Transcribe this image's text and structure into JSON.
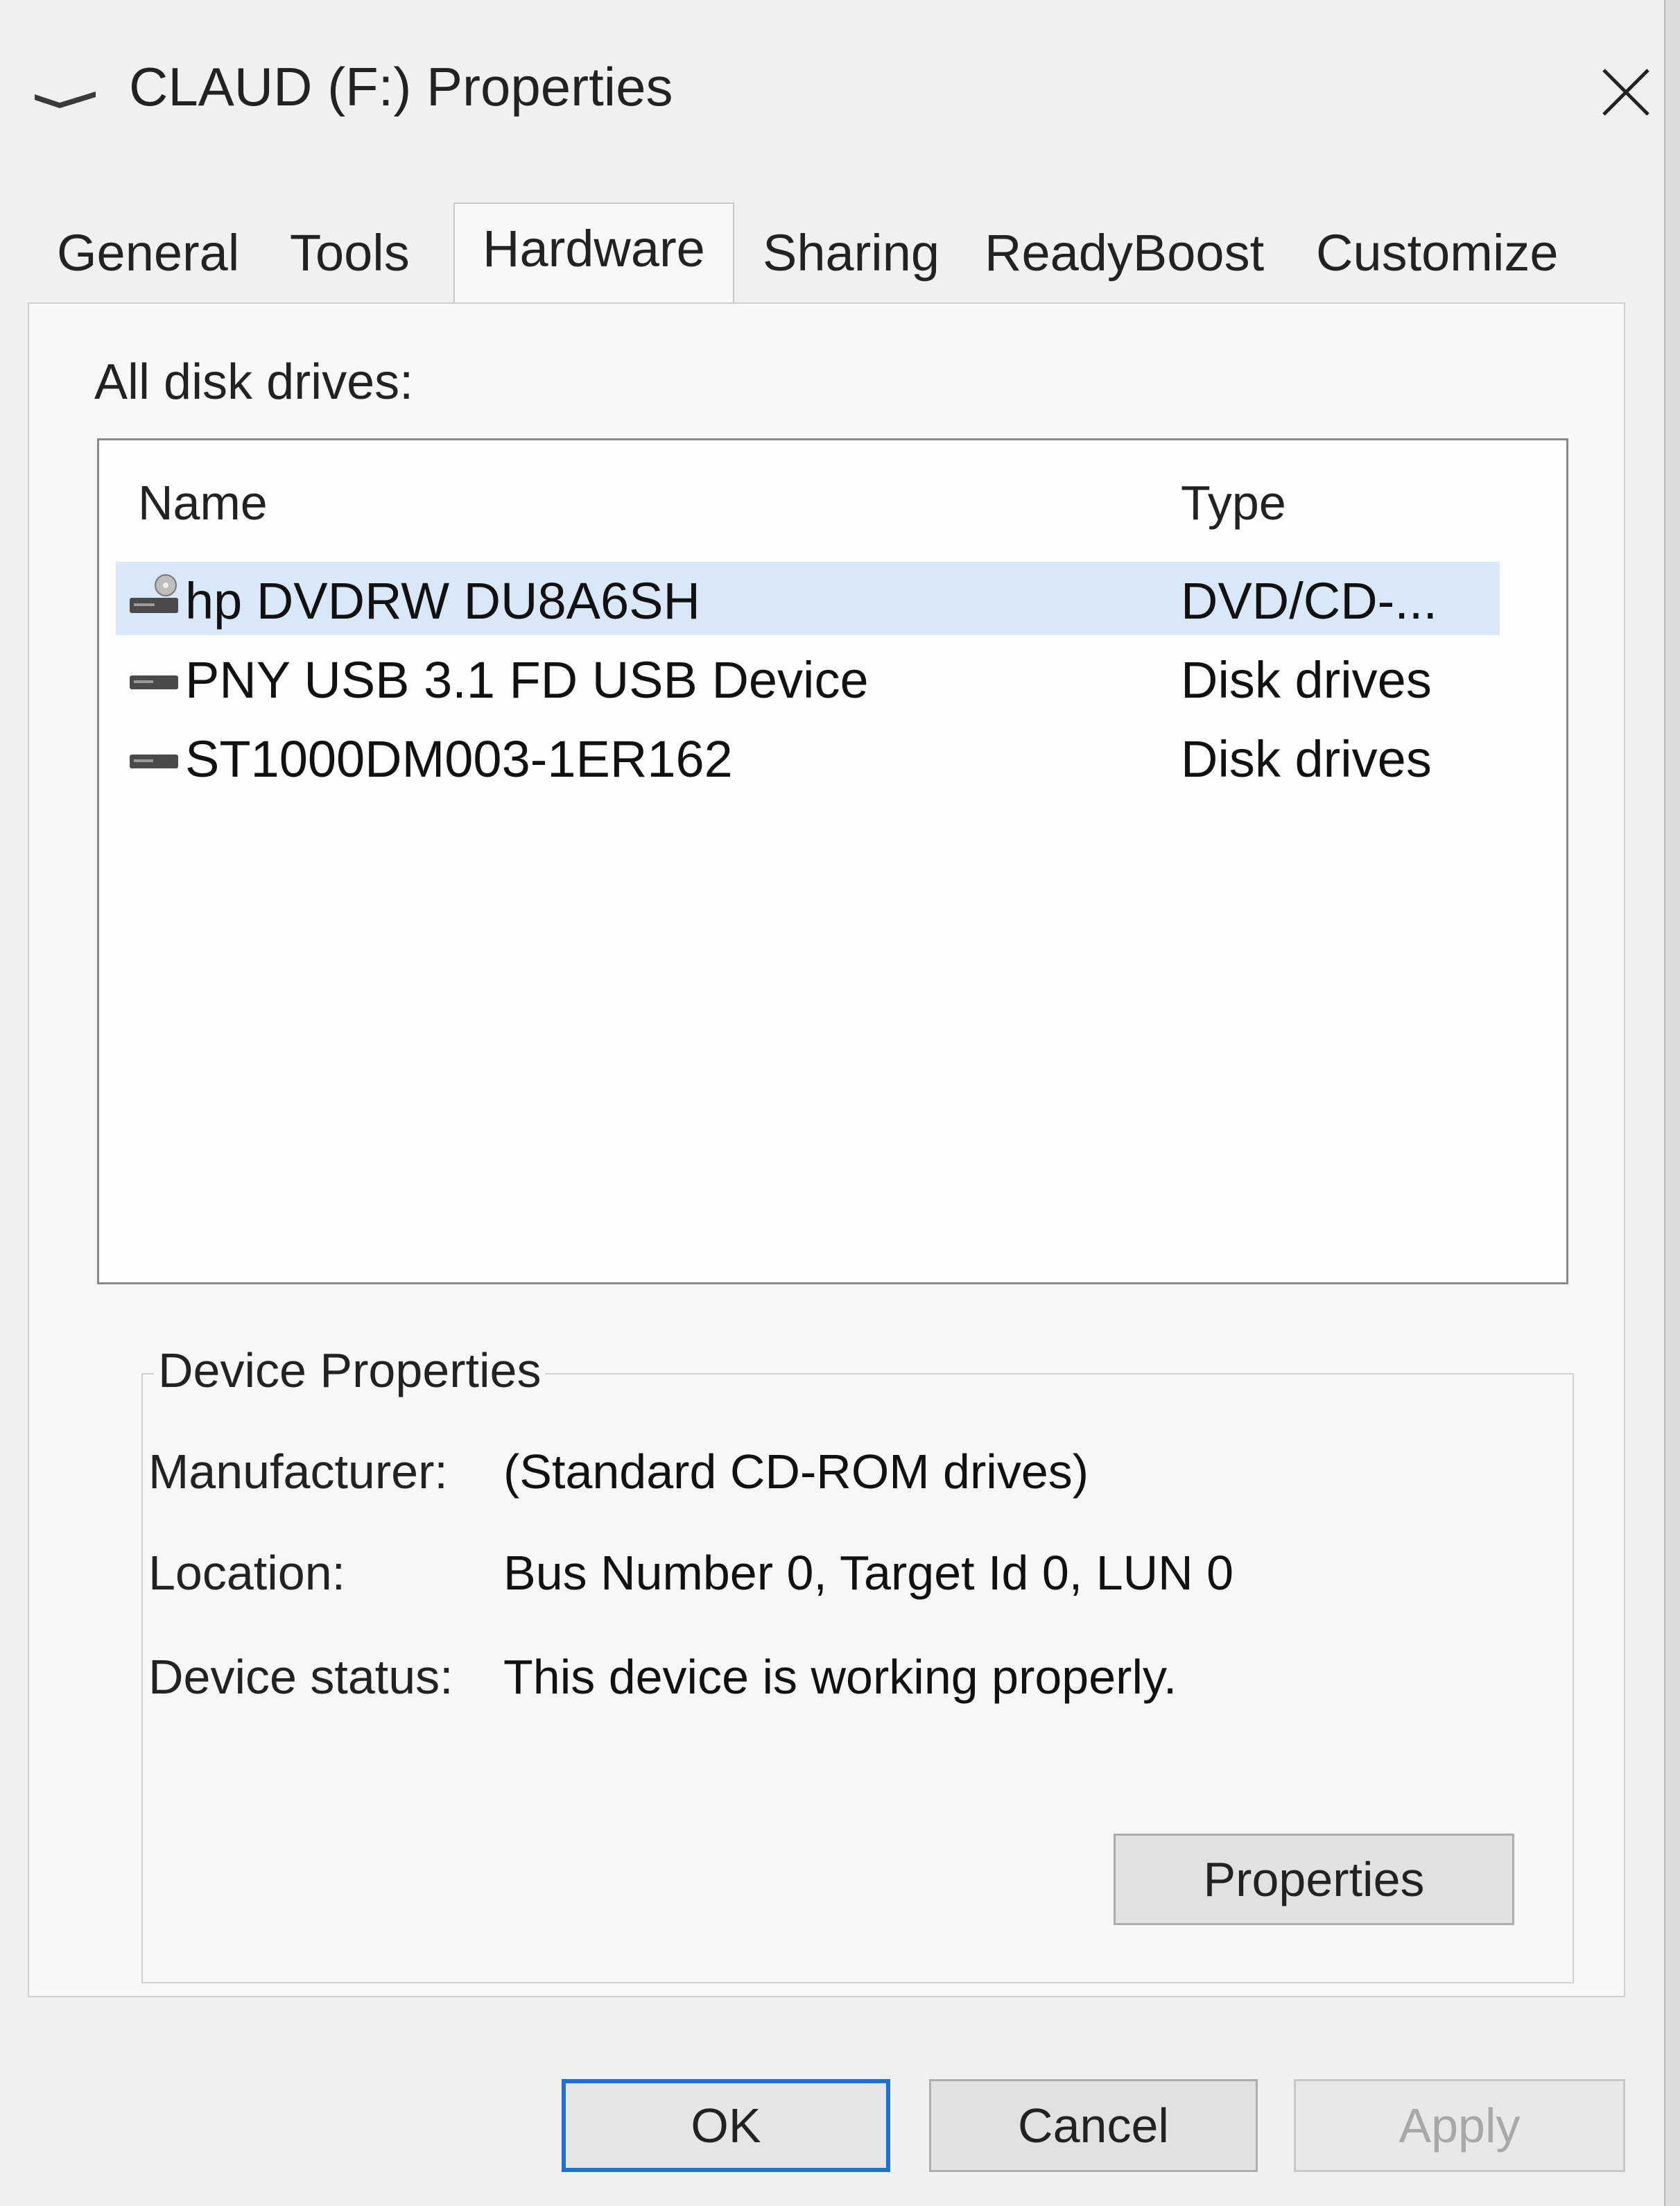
{
  "window": {
    "title": "CLAUD (F:) Properties"
  },
  "tabs": [
    {
      "label": "General",
      "active": false
    },
    {
      "label": "Tools",
      "active": false
    },
    {
      "label": "Hardware",
      "active": true
    },
    {
      "label": "Sharing",
      "active": false
    },
    {
      "label": "ReadyBoost",
      "active": false
    },
    {
      "label": "Customize",
      "active": false
    }
  ],
  "hardware": {
    "list_label": "All disk drives:",
    "columns": {
      "name": "Name",
      "type": "Type"
    },
    "drives": [
      {
        "name": "hp DVDRW  DU8A6SH",
        "type": "DVD/CD-...",
        "icon": "dvd-drive-icon",
        "selected": true
      },
      {
        "name": "PNY USB 3.1 FD USB Device",
        "type": "Disk drives",
        "icon": "disk-drive-icon",
        "selected": false
      },
      {
        "name": "ST1000DM003-1ER162",
        "type": "Disk drives",
        "icon": "disk-drive-icon",
        "selected": false
      }
    ]
  },
  "device_properties": {
    "title": "Device Properties",
    "manufacturer_label": "Manufacturer:",
    "manufacturer_value": "(Standard CD-ROM drives)",
    "location_label": "Location:",
    "location_value": "Bus Number 0, Target Id 0, LUN 0",
    "status_label": "Device status:",
    "status_value": "This device is working properly.",
    "properties_button": "Properties"
  },
  "buttons": {
    "ok": "OK",
    "cancel": "Cancel",
    "apply": "Apply"
  },
  "colors": {
    "selection": "#d9e8f8",
    "default_button_border": "#1f6ed4",
    "window_bg": "#f0f0f0"
  }
}
